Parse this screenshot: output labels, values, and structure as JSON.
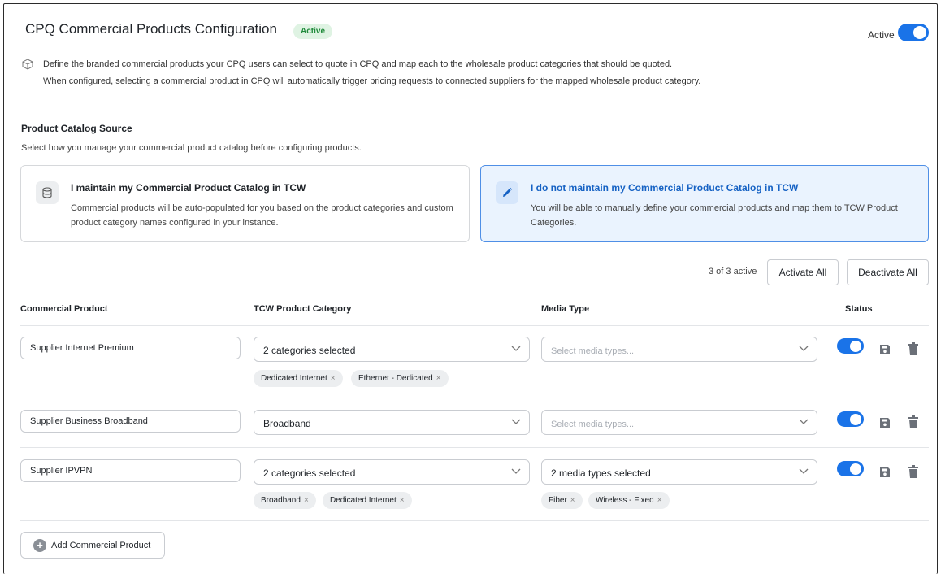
{
  "header": {
    "title": "CPQ Commercial Products Configuration",
    "status_badge": "Active",
    "active_toggle_label": "Active",
    "active_toggle_on": true,
    "description_line1": "Define the branded commercial products your CPQ users can select to quote in CPQ and map each to the wholesale product categories that should be quoted.",
    "description_line2": "When configured, selecting a commercial product in CPQ will automatically trigger pricing requests to connected suppliers for the mapped wholesale product category."
  },
  "catalog_source": {
    "heading": "Product Catalog Source",
    "subheading": "Select how you manage your commercial product catalog before configuring products.",
    "options": [
      {
        "icon": "database-icon",
        "title": "I maintain my Commercial Product Catalog in TCW",
        "description": "Commercial products will be auto-populated for you based on the product categories and custom product category names configured in your instance.",
        "selected": false
      },
      {
        "icon": "pencil-icon",
        "title": "I do not maintain my Commercial Product Catalog in TCW",
        "description": "You will be able to manually define your commercial products and map them to TCW Product Categories.",
        "selected": true
      }
    ]
  },
  "toolbar": {
    "count_text": "3 of 3 active",
    "activate_all_label": "Activate All",
    "deactivate_all_label": "Deactivate All"
  },
  "table": {
    "columns": [
      "Commercial Product",
      "TCW Product Category",
      "Media Type",
      "Status"
    ],
    "rows": [
      {
        "product": "Supplier Internet Premium",
        "category_text": "2 categories selected",
        "category_chips": [
          "Dedicated Internet",
          "Ethernet - Dedicated"
        ],
        "media_text": "",
        "media_placeholder": "Select media types...",
        "media_chips": [],
        "active": true
      },
      {
        "product": "Supplier Business Broadband",
        "category_text": "Broadband",
        "category_chips": [],
        "media_text": "",
        "media_placeholder": "Select media types...",
        "media_chips": [],
        "active": true
      },
      {
        "product": "Supplier IPVPN",
        "category_text": "2 categories selected",
        "category_chips": [
          "Broadband",
          "Dedicated Internet"
        ],
        "media_text": "2 media types selected",
        "media_placeholder": "Select media types...",
        "media_chips": [
          "Fiber",
          "Wireless - Fixed"
        ],
        "active": true
      }
    ]
  },
  "footer": {
    "add_button_label": "Add Commercial Product"
  },
  "colors": {
    "accent": "#1a73e8",
    "badge_bg": "#dff3e3",
    "badge_text": "#1f8a3a",
    "selected_card_bg": "#eaf3fe"
  },
  "chip_remove_glyph": "×"
}
